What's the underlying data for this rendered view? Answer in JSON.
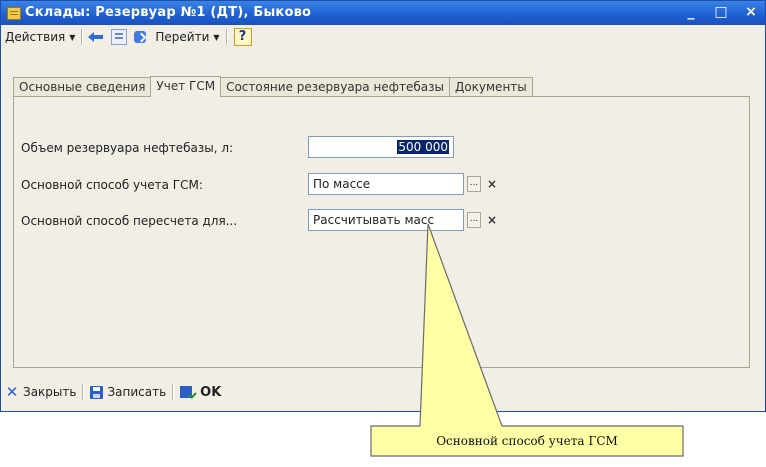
{
  "window": {
    "title": "Склады: Резервуар №1 (ДТ), Быково",
    "controls": [
      "_",
      "□",
      "×"
    ]
  },
  "toolbar": {
    "actions_label": "Действия",
    "goto_label": "Перейти",
    "help_label": "?"
  },
  "tabs": [
    {
      "label": "Основные сведения",
      "active": false
    },
    {
      "label": "Учет ГСМ",
      "active": true
    },
    {
      "label": "Состояние резервуара нефтебазы",
      "active": false
    },
    {
      "label": "Документы",
      "active": false
    }
  ],
  "form": {
    "volume_label": "Объем резервуара нефтебазы, л:",
    "volume_value": "500 000",
    "accounting_label": "Основной способ учета ГСМ:",
    "accounting_value": "По массе",
    "recalc_label": "Основной способ пересчета для...",
    "recalc_value": "Рассчитывать масс",
    "pick_symbol": "...",
    "clear_symbol": "×"
  },
  "bottombar": {
    "close_label": "Закрыть",
    "save_label": "Записать",
    "ok_label": "OK"
  },
  "callout": {
    "text": "Основной способ учета ГСМ"
  },
  "colors": {
    "titlebar": "#1f5fd0",
    "callout_fill": "#ffffa6",
    "callout_stroke": "#6b6b6b"
  }
}
